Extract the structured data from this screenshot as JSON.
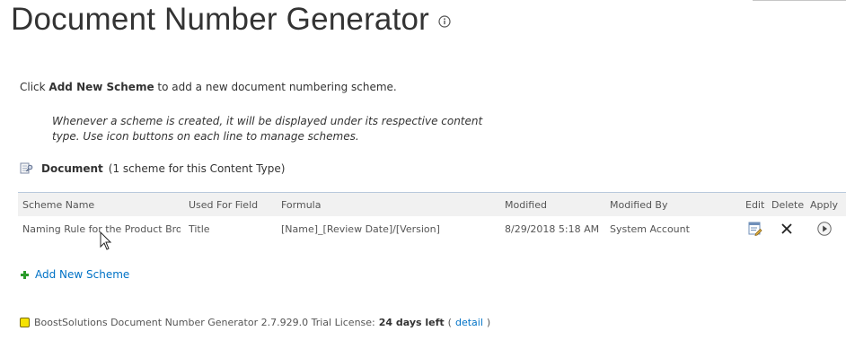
{
  "page": {
    "title": "Document Number Generator"
  },
  "intro": {
    "prefix": "Click ",
    "strong": "Add New Scheme",
    "suffix": " to add a new document numbering scheme."
  },
  "note": {
    "text": "Whenever a scheme is created, it will be displayed under its respective content type. Use icon buttons on each line to manage schemes."
  },
  "content_type": {
    "name": "Document",
    "summary": "(1 scheme for this Content Type)"
  },
  "table": {
    "headers": [
      "Scheme Name",
      "Used For Field",
      "Formula",
      "Modified",
      "Modified By",
      "Edit",
      "Delete",
      "Apply"
    ],
    "rows": [
      {
        "scheme_name": "Naming Rule for the Product Bro",
        "used_for_field": "Title",
        "formula": "[Name]_[Review Date]/[Version]",
        "modified": "8/29/2018 5:18 AM",
        "modified_by": "System Account"
      }
    ]
  },
  "actions": {
    "add_new": "Add New Scheme"
  },
  "footer": {
    "prefix": "BoostSolutions Document Number Generator 2.7.929.0 Trial License: ",
    "days_left": "24 days left",
    "open": " (",
    "detail": "detail",
    "close": ")"
  },
  "icons": {
    "info": "info-icon",
    "content_type": "document-key-icon",
    "edit": "edit-icon",
    "delete": "close-icon",
    "apply": "play-icon",
    "add": "plus-icon",
    "license": "yellow-square-icon",
    "cursor": "mouse-cursor-icon"
  },
  "colors": {
    "link": "#0072c6",
    "header_bg": "#f1f1f1",
    "table_rule": "#b9c9dc",
    "add_icon": "#2b9b2b",
    "license_badge": "#f5e200"
  }
}
